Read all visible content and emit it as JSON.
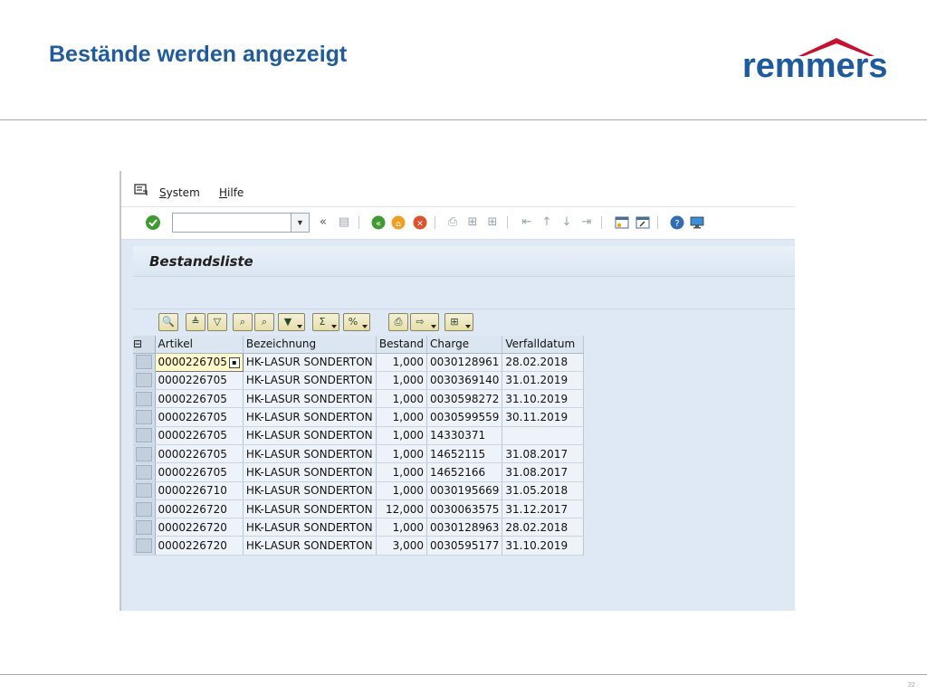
{
  "slide": {
    "title": "Bestände werden angezeigt",
    "logo_text": "remmers",
    "page_number": "22",
    "colors": {
      "title": "#1f5b9e",
      "logo_text": "#1e5aa0",
      "logo_roof": "#c8102e"
    }
  },
  "menubar": {
    "icon": "menu-window-icon",
    "items": [
      {
        "label": "System",
        "mnemonic": "S",
        "rest": "ystem"
      },
      {
        "label": "Hilfe",
        "mnemonic": "H",
        "rest": "ilfe"
      }
    ]
  },
  "toolbar": {
    "command_field_value": "",
    "icons": [
      "enter-check-icon",
      "command-dropdown-icon",
      "collapse-chevron-icon",
      "save-icon",
      "back-icon",
      "exit-icon",
      "cancel-icon",
      "print-icon",
      "find-icon",
      "find-next-icon",
      "first-page-icon",
      "previous-page-icon",
      "next-page-icon",
      "last-page-icon",
      "create-session-icon",
      "shortcut-icon",
      "help-icon",
      "customize-layout-icon"
    ]
  },
  "screen": {
    "title": "Bestandsliste"
  },
  "alv_toolbar": {
    "icons": [
      "details-icon",
      "sort-ascending-icon",
      "sort-descending-icon",
      "find-icon",
      "find-next-icon",
      "filter-icon",
      "sum-icon",
      "subtotal-icon",
      "print-preview-icon",
      "export-icon",
      "layout-icon"
    ]
  },
  "grid": {
    "columns": [
      "Artikel",
      "Bezeichnung",
      "Bestand",
      "Charge",
      "Verfalldatum"
    ],
    "rows": [
      [
        "0000226705",
        "HK-LASUR SONDERTON",
        "1,000",
        "0030128961",
        "28.02.2018"
      ],
      [
        "0000226705",
        "HK-LASUR SONDERTON",
        "1,000",
        "0030369140",
        "31.01.2019"
      ],
      [
        "0000226705",
        "HK-LASUR SONDERTON",
        "1,000",
        "0030598272",
        "31.10.2019"
      ],
      [
        "0000226705",
        "HK-LASUR SONDERTON",
        "1,000",
        "0030599559",
        "30.11.2019"
      ],
      [
        "0000226705",
        "HK-LASUR SONDERTON",
        "1,000",
        "14330371",
        ""
      ],
      [
        "0000226705",
        "HK-LASUR SONDERTON",
        "1,000",
        "14652115",
        "31.08.2017"
      ],
      [
        "0000226705",
        "HK-LASUR SONDERTON",
        "1,000",
        "14652166",
        "31.08.2017"
      ],
      [
        "0000226710",
        "HK-LASUR SONDERTON",
        "1,000",
        "0030195669",
        "31.05.2018"
      ],
      [
        "0000226720",
        "HK-LASUR SONDERTON",
        "12,000",
        "0030063575",
        "31.12.2017"
      ],
      [
        "0000226720",
        "HK-LASUR SONDERTON",
        "1,000",
        "0030128963",
        "28.02.2018"
      ],
      [
        "0000226720",
        "HK-LASUR SONDERTON",
        "3,000",
        "0030595177",
        "31.10.2019"
      ]
    ]
  }
}
